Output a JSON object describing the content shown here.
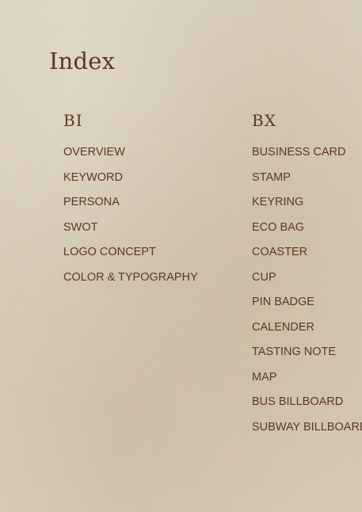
{
  "title": "Index",
  "bi": {
    "heading": "BI",
    "items": [
      "OVERVIEW",
      "KEYWORD",
      "PERSONA",
      "SWOT",
      "LOGO CONCEPT",
      "COLOR & TYPOGRAPHY"
    ]
  },
  "bx": {
    "heading": "BX",
    "items": [
      "BUSINESS CARD",
      "STAMP",
      "KEYRING",
      "ECO BAG",
      "COASTER",
      "CUP",
      "PIN BADGE",
      "CALENDER",
      "TASTING NOTE",
      "MAP",
      "BUS BILLBOARD",
      "SUBWAY BILLBOARD"
    ]
  }
}
